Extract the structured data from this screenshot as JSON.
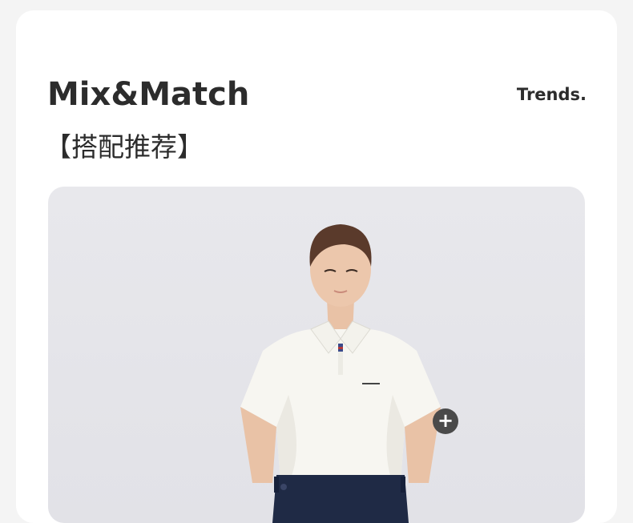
{
  "header": {
    "title": "Mix&Match",
    "subtitle": "【搭配推荐】",
    "trends_label": "Trends."
  },
  "photo": {
    "alt": "model",
    "plus_icon": "plus-icon",
    "plus_label": "+"
  },
  "colors": {
    "background": "#f4f4f4",
    "card": "#ffffff",
    "text": "#2c2c2c",
    "photo_bg": "#e6e6ea",
    "plus_button": "#4a4a4a"
  }
}
